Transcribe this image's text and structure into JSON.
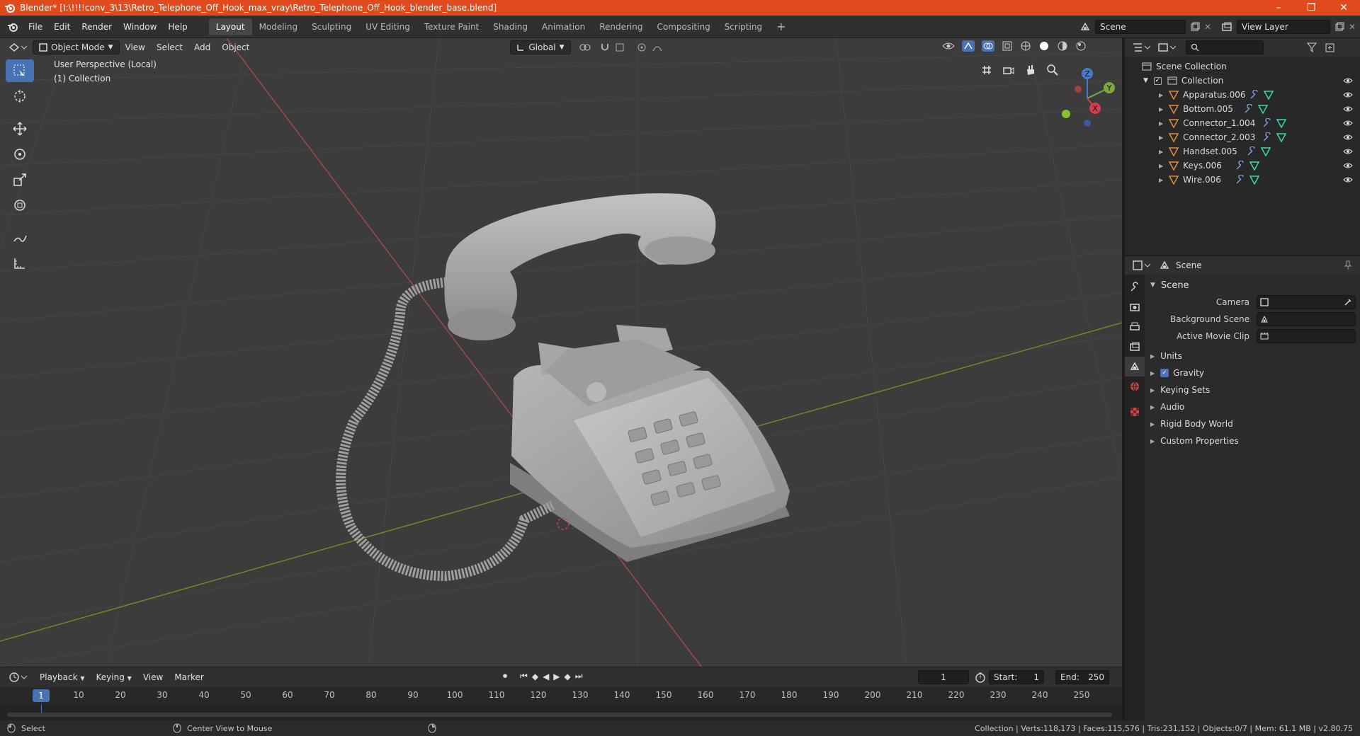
{
  "titlebar": {
    "title": "Blender* [I:\\!!!!conv_3\\13\\Retro_Telephone_Off_Hook_max_vray\\Retro_Telephone_Off_Hook_blender_base.blend]",
    "minimize": "–",
    "maximize": "❐",
    "close": "✕"
  },
  "menu": [
    "File",
    "Edit",
    "Render",
    "Window",
    "Help"
  ],
  "workspaces": [
    "Layout",
    "Modeling",
    "Sculpting",
    "UV Editing",
    "Texture Paint",
    "Shading",
    "Animation",
    "Rendering",
    "Compositing",
    "Scripting"
  ],
  "top_right": {
    "scene": "Scene",
    "view_layer": "View Layer",
    "add": "+"
  },
  "viewport": {
    "mode": "Object Mode",
    "menus": [
      "View",
      "Select",
      "Add",
      "Object"
    ],
    "orientation": "Global",
    "info_line1": "User Perspective (Local)",
    "info_line2": "(1) Collection",
    "gizmo": {
      "z": "Z",
      "y": "Y",
      "x": "X"
    }
  },
  "timeline": {
    "menus": [
      "Playback",
      "Keying",
      "View",
      "Marker"
    ],
    "current_frame": "1",
    "start_label": "Start:",
    "start": "1",
    "end_label": "End:",
    "end": "250",
    "ticks": [
      "1",
      "10",
      "20",
      "30",
      "40",
      "50",
      "60",
      "70",
      "80",
      "90",
      "100",
      "110",
      "120",
      "130",
      "140",
      "150",
      "160",
      "170",
      "180",
      "190",
      "200",
      "210",
      "220",
      "230",
      "240",
      "250"
    ]
  },
  "statusbar": {
    "left_action": "Select",
    "mid_action": "Center View to Mouse",
    "stats": "Collection | Verts:118,173 | Faces:115,576 | Tris:231,152 | Objects:0/7 | Mem: 61.1 MB | v2.80.75"
  },
  "outliner": {
    "root": "Scene Collection",
    "collection": "Collection",
    "objects": [
      "Apparatus.006",
      "Bottom.005",
      "Connector_1.004",
      "Connector_2.003",
      "Handset.005",
      "Keys.006",
      "Wire.006"
    ]
  },
  "properties": {
    "header": "Scene",
    "panel_title": "Scene",
    "camera_label": "Camera",
    "background_label": "Background Scene",
    "movieclip_label": "Active Movie Clip",
    "subpanels": [
      "Units",
      "Gravity",
      "Keying Sets",
      "Audio",
      "Rigid Body World",
      "Custom Properties"
    ]
  },
  "colors": {
    "accent": "#4772b3",
    "titlebar": "#e04a1e",
    "object_icon": "#e08a3c",
    "modifier_icon": "#6ea0e0",
    "mesh_icon": "#3cd7b0"
  }
}
